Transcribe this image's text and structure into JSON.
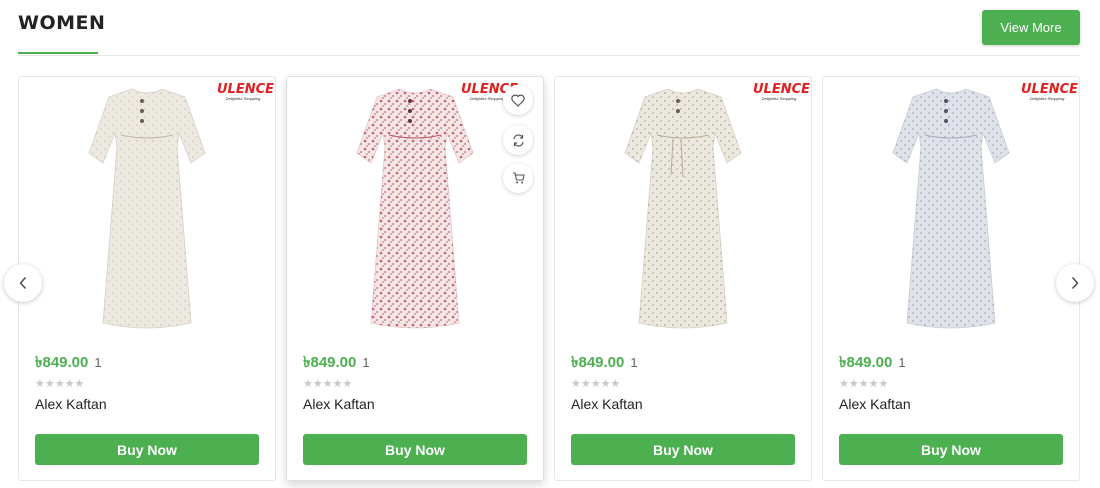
{
  "section": {
    "title": "WOMEN",
    "view_more_label": "View More",
    "accent_color": "#4caf50"
  },
  "brand": {
    "name": "ULENCE",
    "tagline": "Delightful Shopping"
  },
  "products": [
    {
      "price": "৳849.00",
      "qty": "1",
      "rating_stars": "★★★★★",
      "name": "Alex Kaftan",
      "buy_label": "Buy Now",
      "dress_color": "#ece9e2",
      "print_color": "#c9b48e"
    },
    {
      "price": "৳849.00",
      "qty": "1",
      "rating_stars": "★★★★★",
      "name": "Alex Kaftan",
      "buy_label": "Buy Now",
      "dress_color": "#f3e6e6",
      "print_color": "#c9455a"
    },
    {
      "price": "৳849.00",
      "qty": "1",
      "rating_stars": "★★★★★",
      "name": "Alex Kaftan",
      "buy_label": "Buy Now",
      "dress_color": "#ebe8df",
      "print_color": "#a79070"
    },
    {
      "price": "৳849.00",
      "qty": "1",
      "rating_stars": "★★★★★",
      "name": "Alex Kaftan",
      "buy_label": "Buy Now",
      "dress_color": "#dfe2e8",
      "print_color": "#8893a8"
    }
  ],
  "hover_actions": [
    "heart-icon",
    "compare-icon",
    "cart-icon"
  ],
  "carousel": {
    "prev_icon": "chevron-left-icon",
    "next_icon": "chevron-right-icon"
  }
}
